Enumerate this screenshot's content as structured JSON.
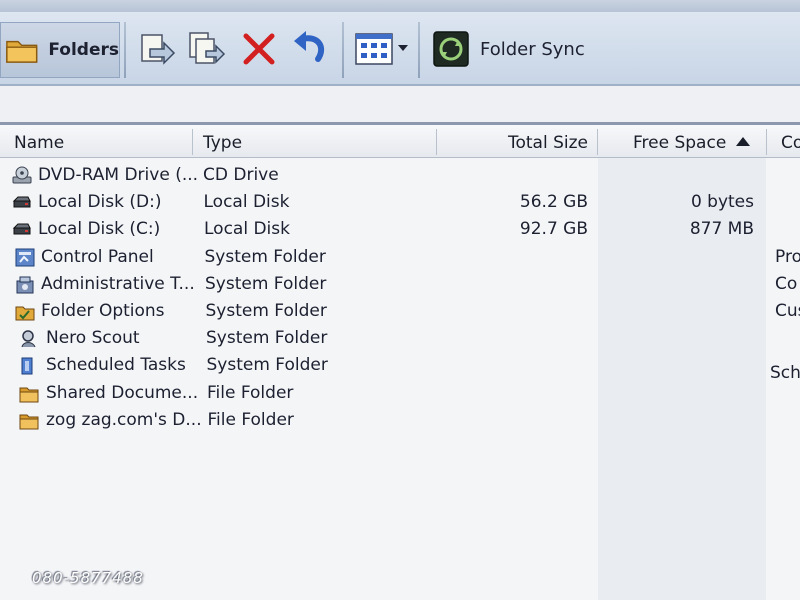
{
  "toolbar": {
    "folders_label": "Folders",
    "folder_sync_label": "Folder Sync"
  },
  "columns": {
    "name": "Name",
    "type": "Type",
    "total_size": "Total Size",
    "free_space": "Free Space",
    "comments_partial": "Co"
  },
  "rows": [
    {
      "name": "DVD-RAM Drive (...",
      "type": "CD Drive",
      "total": "",
      "free": "",
      "comment": "",
      "icon": "dvd-drive-icon"
    },
    {
      "name": "Local Disk (D:)",
      "type": "Local Disk",
      "total": "56.2 GB",
      "free": "0 bytes",
      "comment": "",
      "icon": "hard-disk-icon"
    },
    {
      "name": "Local Disk (C:)",
      "type": "Local Disk",
      "total": "92.7 GB",
      "free": "877 MB",
      "comment": "",
      "icon": "hard-disk-icon"
    },
    {
      "name": "Control Panel",
      "type": "System Folder",
      "total": "",
      "free": "",
      "comment": "Pro",
      "icon": "control-panel-icon"
    },
    {
      "name": "Administrative T...",
      "type": "System Folder",
      "total": "",
      "free": "",
      "comment": "Co",
      "icon": "administrative-tools-icon"
    },
    {
      "name": "Folder Options",
      "type": "System Folder",
      "total": "",
      "free": "",
      "comment": "Cus",
      "icon": "folder-options-icon"
    },
    {
      "name": "Nero Scout",
      "type": "System Folder",
      "total": "",
      "free": "",
      "comment": "",
      "icon": "nero-scout-icon"
    },
    {
      "name": "Scheduled Tasks",
      "type": "System Folder",
      "total": "",
      "free": "",
      "comment": "Sch",
      "icon": "scheduled-tasks-icon"
    },
    {
      "name": "Shared Docume...",
      "type": "File Folder",
      "total": "",
      "free": "",
      "comment": "",
      "icon": "folder-icon"
    },
    {
      "name": "zog zag.com's D...",
      "type": "File Folder",
      "total": "",
      "free": "",
      "comment": "",
      "icon": "folder-icon"
    }
  ],
  "watermark": "080-5877488",
  "colors": {
    "toolbar_bg": "#c8d5e6",
    "delete_red": "#d21f1f",
    "undo_blue": "#2f63c4",
    "sorted_column_bg": "#e9ecf1"
  }
}
